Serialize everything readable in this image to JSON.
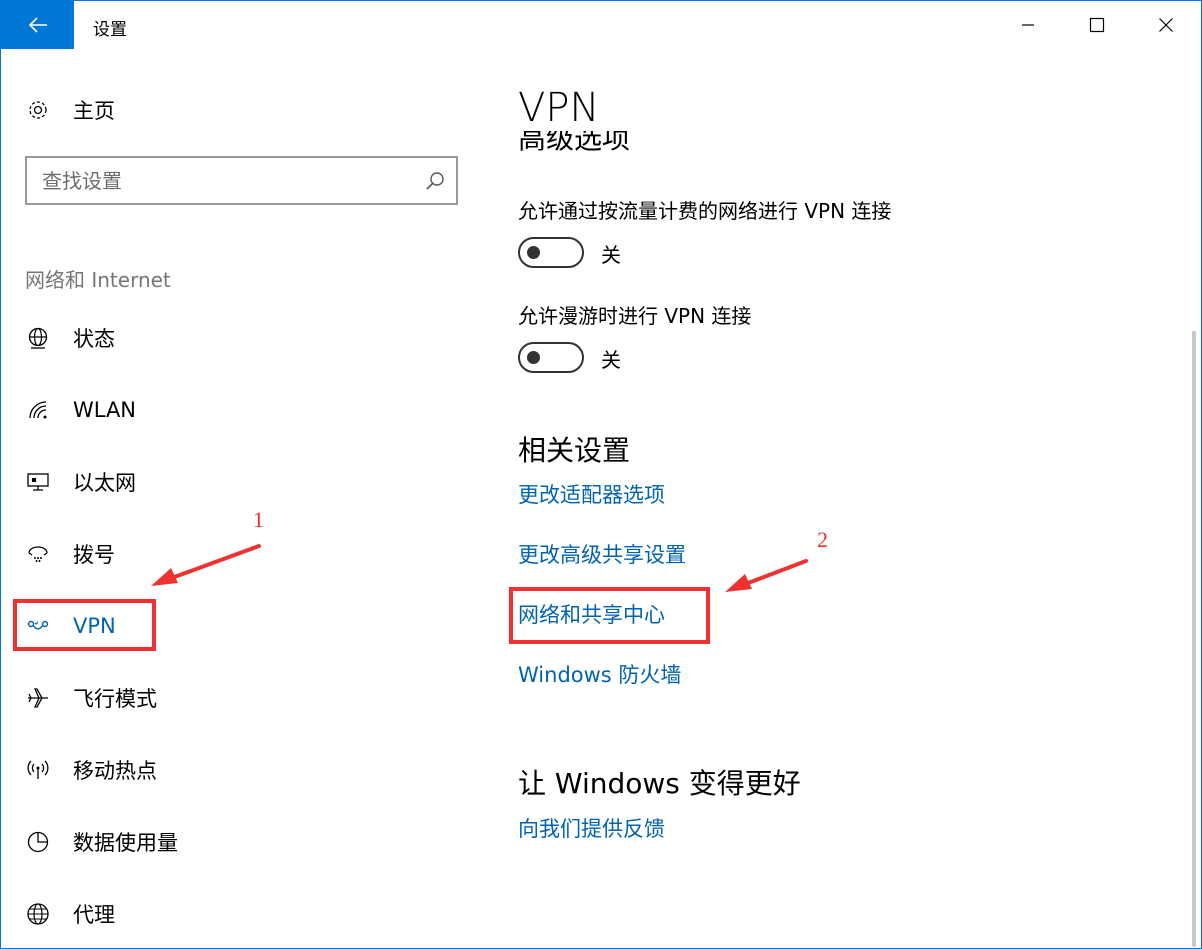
{
  "window": {
    "title": "设置",
    "accent_color": "#0078d7",
    "link_color": "#0063b1",
    "back_icon": "arrow-left-icon",
    "minimize_icon": "minimize-icon",
    "maximize_icon": "maximize-icon",
    "close_icon": "close-icon"
  },
  "sidebar": {
    "home": {
      "label": "主页",
      "icon": "gear-icon"
    },
    "search": {
      "placeholder": "查找设置",
      "icon": "search-icon"
    },
    "section_title": "网络和 Internet",
    "items": [
      {
        "label": "状态",
        "icon": "globe-status-icon"
      },
      {
        "label": "WLAN",
        "icon": "wifi-icon"
      },
      {
        "label": "以太网",
        "icon": "ethernet-icon"
      },
      {
        "label": "拨号",
        "icon": "dialup-icon"
      },
      {
        "label": "VPN",
        "icon": "vpn-icon",
        "selected": true
      },
      {
        "label": "飞行模式",
        "icon": "airplane-icon"
      },
      {
        "label": "移动热点",
        "icon": "hotspot-icon"
      },
      {
        "label": "数据使用量",
        "icon": "data-usage-icon"
      },
      {
        "label": "代理",
        "icon": "globe-icon"
      }
    ]
  },
  "main": {
    "title": "VPN",
    "advanced_heading": "高级选项",
    "options": [
      {
        "label": "允许通过按流量计费的网络进行 VPN 连接",
        "state": "关",
        "on": false
      },
      {
        "label": "允许漫游时进行 VPN 连接",
        "state": "关",
        "on": false
      }
    ],
    "related": {
      "heading": "相关设置",
      "links": [
        "更改适配器选项",
        "更改高级共享设置",
        "网络和共享中心",
        "Windows 防火墙"
      ]
    },
    "feedback": {
      "heading": "让 Windows 变得更好",
      "link": "向我们提供反馈"
    }
  },
  "annotations": {
    "color": "#ef3131",
    "marker_1": "1",
    "marker_2": "2"
  }
}
